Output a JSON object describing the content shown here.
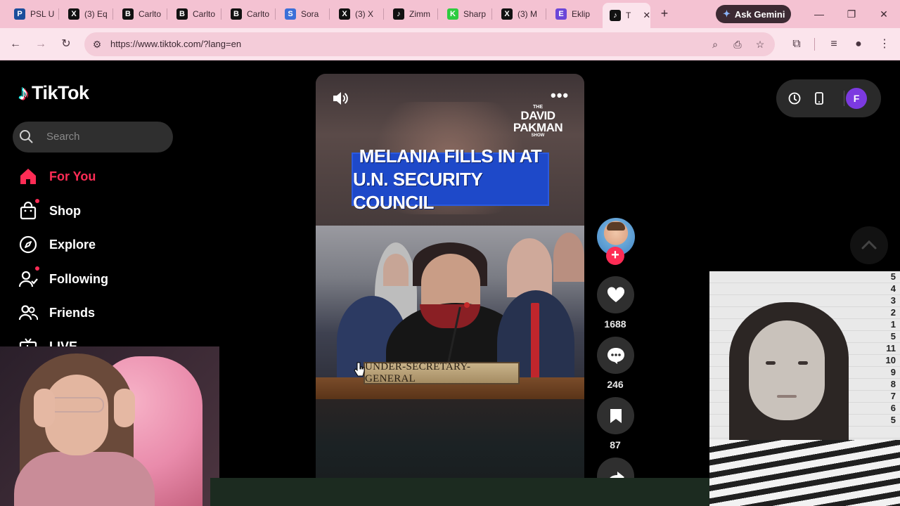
{
  "browser": {
    "tabs": [
      {
        "label": "PSL U",
        "favicon": "shield-icon",
        "color": "#1b4d9b",
        "glyph": "P"
      },
      {
        "label": "(3) Eq",
        "favicon": "x-logo-icon",
        "color": "#111111",
        "glyph": "X"
      },
      {
        "label": "Carlto",
        "favicon": "b-logo-icon",
        "color": "#111111",
        "glyph": "B"
      },
      {
        "label": "Carlto",
        "favicon": "b-logo-icon",
        "color": "#111111",
        "glyph": "B"
      },
      {
        "label": "Carlto",
        "favicon": "b-logo-icon",
        "color": "#111111",
        "glyph": "B"
      },
      {
        "label": "Sora",
        "favicon": "sora-icon",
        "color": "#3b6fd8",
        "glyph": "S"
      },
      {
        "label": "(3) X",
        "favicon": "x-logo-icon",
        "color": "#111111",
        "glyph": "X"
      },
      {
        "label": "Zimm",
        "favicon": "tiktok-icon",
        "color": "#111111",
        "glyph": "♪"
      },
      {
        "label": "Sharp",
        "favicon": "k-logo-icon",
        "color": "#2ecc40",
        "glyph": "K"
      },
      {
        "label": "(3) M",
        "favicon": "x-logo-icon",
        "color": "#111111",
        "glyph": "X"
      },
      {
        "label": "Eklip",
        "favicon": "eklipse-icon",
        "color": "#6b46d8",
        "glyph": "E"
      },
      {
        "label": "T",
        "favicon": "tiktok-icon",
        "color": "#111111",
        "glyph": "♪",
        "active": true
      }
    ],
    "new_tab": "+",
    "gemini_label": "Ask Gemini",
    "url": "https://www.tiktok.com/?lang=en",
    "window_controls": {
      "minimize": "—",
      "restore": "❐",
      "close": "✕"
    },
    "colors": {
      "chrome": "#f4c2d2",
      "toolbar": "#fbe4ec"
    }
  },
  "tiktok": {
    "brand": "TikTok",
    "search_placeholder": "Search",
    "nav": [
      {
        "label": "For You",
        "icon": "home-icon",
        "active": true
      },
      {
        "label": "Shop",
        "icon": "shopping-bag-icon",
        "dot": true
      },
      {
        "label": "Explore",
        "icon": "compass-icon"
      },
      {
        "label": "Following",
        "icon": "following-icon",
        "dot": true
      },
      {
        "label": "Friends",
        "icon": "friends-icon"
      },
      {
        "label": "LIVE",
        "icon": "live-tv-icon"
      }
    ],
    "accent": "#fe2c55",
    "video": {
      "headline_line1": "MELANIA FILLS IN AT",
      "headline_line2": "U.N. SECURITY COUNCIL",
      "show_line1": "THE",
      "show_line2": "DAVID",
      "show_line3": "PAKMAN",
      "show_line4": "SHOW",
      "nameplate": "UNDER-SECRETARY-GENERAL"
    },
    "actions": {
      "likes": "1688",
      "comments": "246",
      "saves": "87"
    },
    "profile_initial": "F"
  },
  "mugshot_scale": [
    "5",
    "4",
    "3",
    "2",
    "1",
    "5",
    "11",
    "10",
    "9",
    "8",
    "7",
    "6",
    "5"
  ]
}
